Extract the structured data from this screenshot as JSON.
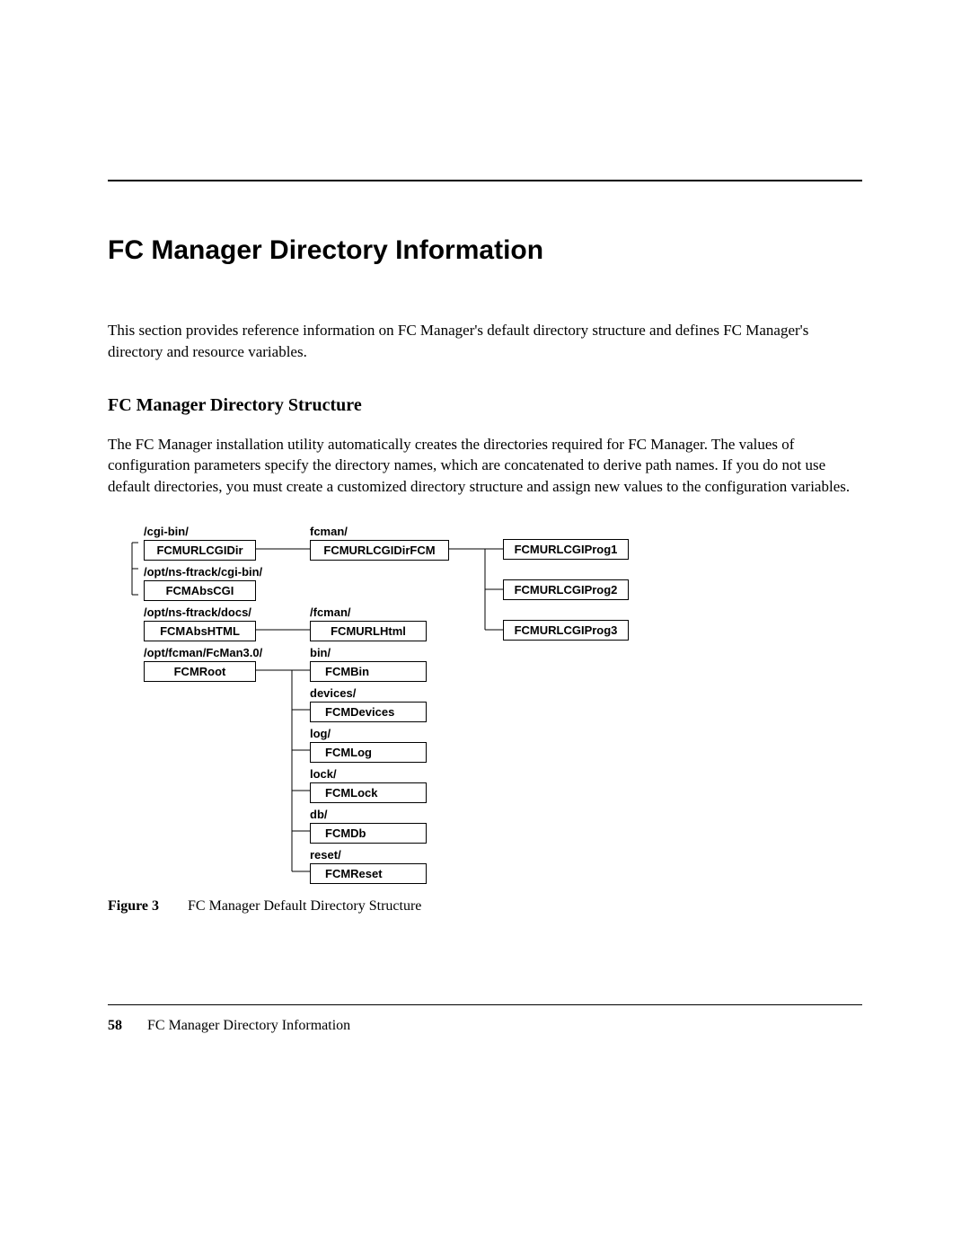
{
  "title": "FC Manager Directory Information",
  "intro": "This section provides reference information on FC Manager's default directory structure and defines FC Manager's directory and resource variables.",
  "subhead": "FC Manager Directory Structure",
  "body": "The FC Manager installation utility automatically creates the directories required for FC Manager. The values of configuration parameters specify the directory names, which are concatenated to derive path names. If you do not use default directories, you must create a customized directory structure and assign new values to the configuration variables.",
  "diagram": {
    "col1": {
      "n1": {
        "label": "/cgi-bin/",
        "box": "FCMURLCGIDir"
      },
      "n2": {
        "label": "/opt/ns-ftrack/cgi-bin/",
        "box": "FCMAbsCGI"
      },
      "n3": {
        "label": "/opt/ns-ftrack/docs/",
        "box": "FCMAbsHTML"
      },
      "n4": {
        "label": "/opt/fcman/FcMan3.0/",
        "box": "FCMRoot"
      }
    },
    "col2": {
      "n1": {
        "label": "fcman/",
        "box": "FCMURLCGIDirFCM"
      },
      "n2": {
        "label": "/fcman/",
        "box": "FCMURLHtml"
      },
      "n3": {
        "label": "bin/",
        "box": "FCMBin"
      },
      "n4": {
        "label": "devices/",
        "box": "FCMDevices"
      },
      "n5": {
        "label": "log/",
        "box": "FCMLog"
      },
      "n6": {
        "label": "lock/",
        "box": "FCMLock"
      },
      "n7": {
        "label": "db/",
        "box": "FCMDb"
      },
      "n8": {
        "label": "reset/",
        "box": "FCMReset"
      }
    },
    "col3": {
      "n1": {
        "box": "FCMURLCGIProg1"
      },
      "n2": {
        "box": "FCMURLCGIProg2"
      },
      "n3": {
        "box": "FCMURLCGIProg3"
      }
    }
  },
  "figure": {
    "label": "Figure 3",
    "caption": "FC Manager Default Directory Structure"
  },
  "footer": {
    "page_num": "58",
    "text": "FC Manager Directory Information"
  }
}
